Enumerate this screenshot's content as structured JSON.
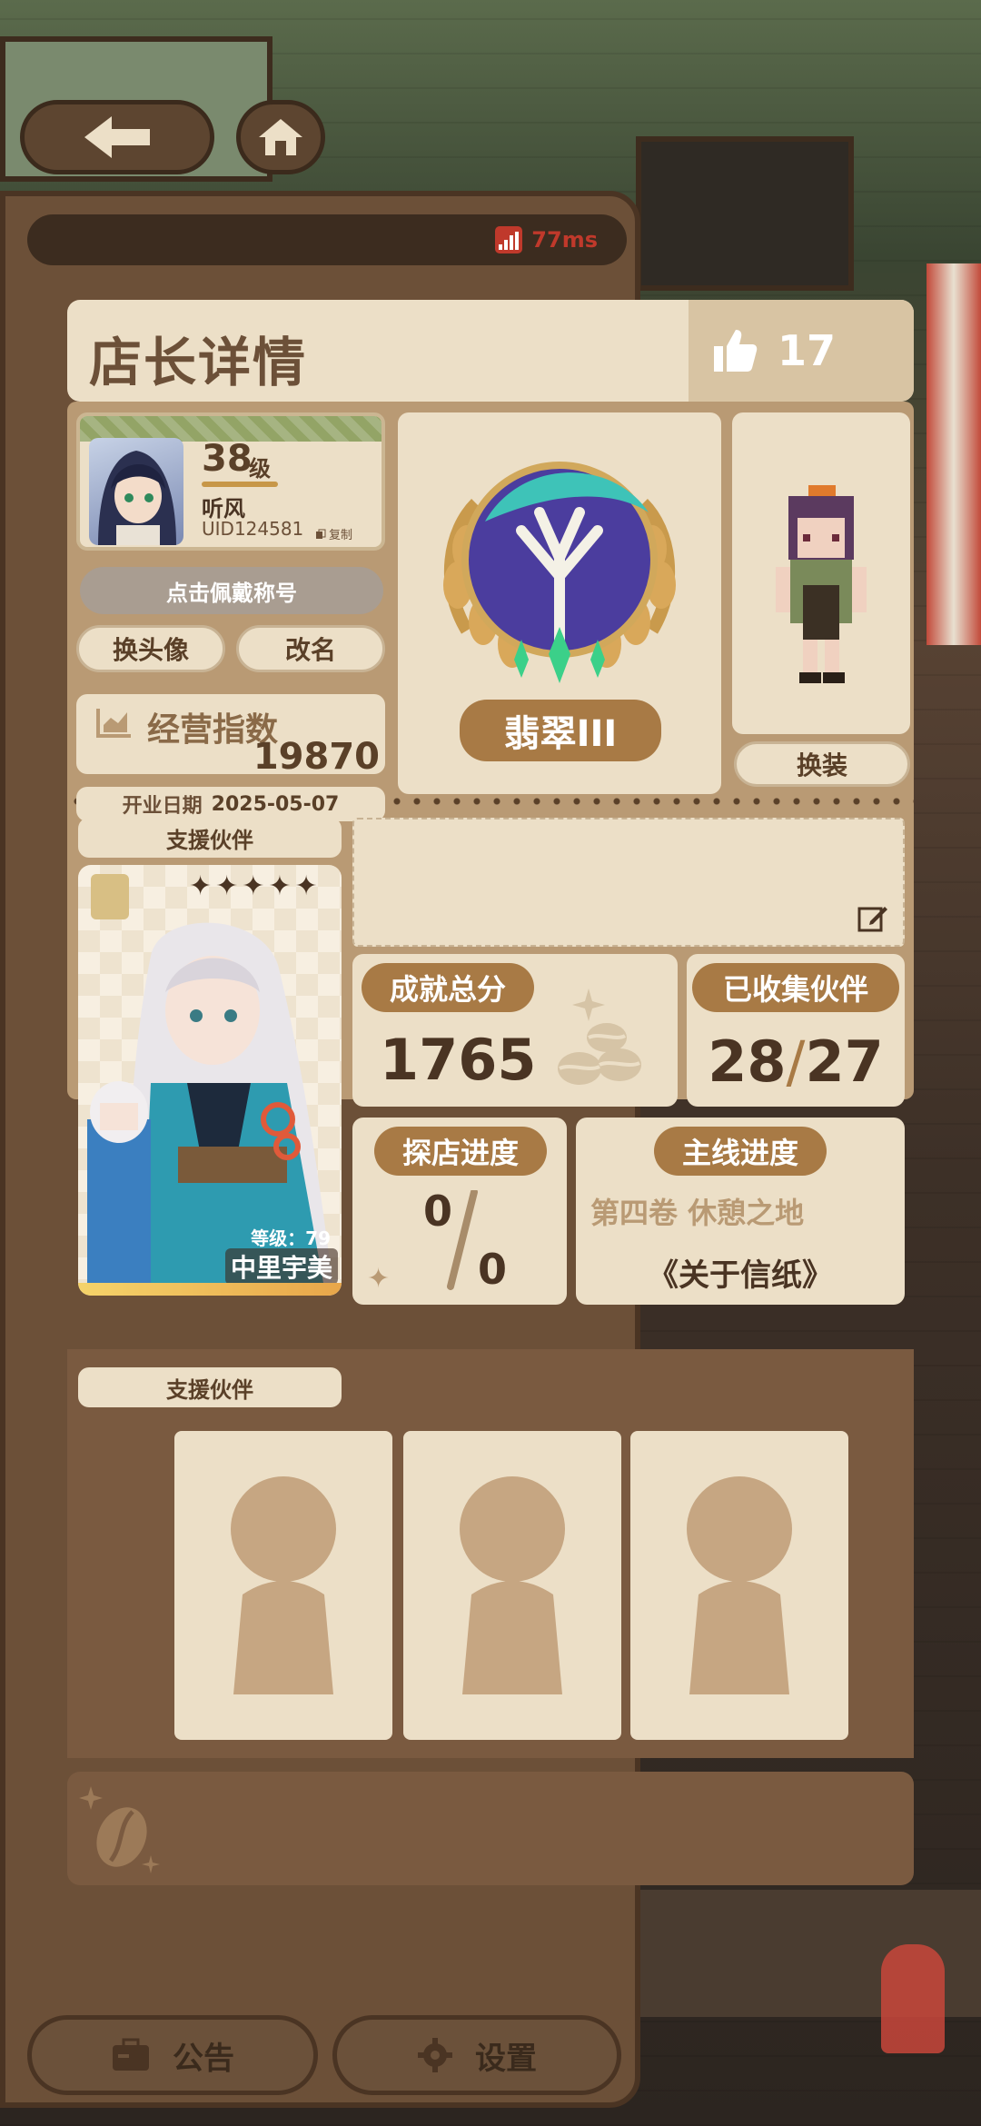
{
  "panel": {
    "title": "店长详情",
    "likes": "17"
  },
  "status": {
    "ping": "77ms"
  },
  "profile": {
    "level": "38",
    "level_unit": "级",
    "nickname": "听风",
    "uid": "UID124581",
    "copy_label": "复制",
    "wear_title_label": "点击佩戴称号",
    "change_avatar_label": "换头像",
    "rename_label": "改名",
    "business_index_label": "经营指数",
    "business_index_value": "19870",
    "open_date_label": "开业日期",
    "open_date_value": "2025-05-07"
  },
  "rank": {
    "name": "翡翠III"
  },
  "character": {
    "change_outfit_label": "换装"
  },
  "support": {
    "tab_label": "支援伙伴",
    "partner_name": "中里宇美",
    "partner_level_text": "等级：79",
    "partner_stars": 5
  },
  "stats": {
    "achievement_label": "成就总分",
    "achievement_value": "1765",
    "collected_label": "已收集伙伴",
    "collected_owned": "28",
    "collected_separator": "/",
    "collected_total": "27",
    "explore_label": "探店进度",
    "explore_done": "0",
    "explore_total": "0",
    "main_label": "主线进度",
    "main_volume": "第四卷 休憩之地",
    "main_chapter": "《关于信纸》"
  },
  "support_slots": {
    "tab_label": "支援伙伴",
    "slot_count": 3
  },
  "bottom": {
    "announcement_label": "公告",
    "settings_label": "设置"
  },
  "colors": {
    "panel_bg": "#ecdfc7",
    "section_bg": "#b99a74",
    "accent_brown": "#a87a45",
    "text_dark": "#4a3423",
    "ping_red": "#c0392b"
  }
}
